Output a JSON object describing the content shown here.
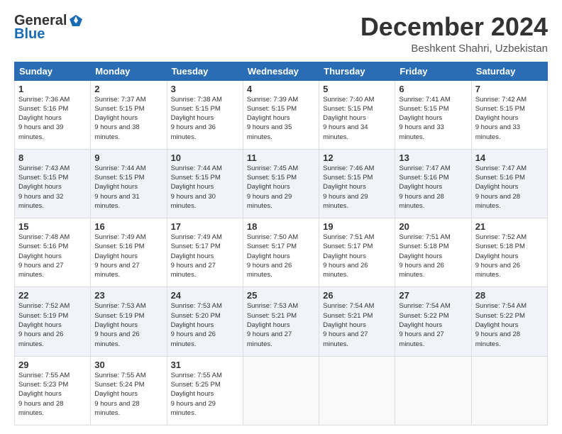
{
  "header": {
    "logo_general": "General",
    "logo_blue": "Blue",
    "month_title": "December 2024",
    "location": "Beshkent Shahri, Uzbekistan"
  },
  "days_of_week": [
    "Sunday",
    "Monday",
    "Tuesday",
    "Wednesday",
    "Thursday",
    "Friday",
    "Saturday"
  ],
  "weeks": [
    [
      {
        "day": "1",
        "sunrise": "7:36 AM",
        "sunset": "5:16 PM",
        "daylight": "9 hours and 39 minutes."
      },
      {
        "day": "2",
        "sunrise": "7:37 AM",
        "sunset": "5:15 PM",
        "daylight": "9 hours and 38 minutes."
      },
      {
        "day": "3",
        "sunrise": "7:38 AM",
        "sunset": "5:15 PM",
        "daylight": "9 hours and 36 minutes."
      },
      {
        "day": "4",
        "sunrise": "7:39 AM",
        "sunset": "5:15 PM",
        "daylight": "9 hours and 35 minutes."
      },
      {
        "day": "5",
        "sunrise": "7:40 AM",
        "sunset": "5:15 PM",
        "daylight": "9 hours and 34 minutes."
      },
      {
        "day": "6",
        "sunrise": "7:41 AM",
        "sunset": "5:15 PM",
        "daylight": "9 hours and 33 minutes."
      },
      {
        "day": "7",
        "sunrise": "7:42 AM",
        "sunset": "5:15 PM",
        "daylight": "9 hours and 33 minutes."
      }
    ],
    [
      {
        "day": "8",
        "sunrise": "7:43 AM",
        "sunset": "5:15 PM",
        "daylight": "9 hours and 32 minutes."
      },
      {
        "day": "9",
        "sunrise": "7:44 AM",
        "sunset": "5:15 PM",
        "daylight": "9 hours and 31 minutes."
      },
      {
        "day": "10",
        "sunrise": "7:44 AM",
        "sunset": "5:15 PM",
        "daylight": "9 hours and 30 minutes."
      },
      {
        "day": "11",
        "sunrise": "7:45 AM",
        "sunset": "5:15 PM",
        "daylight": "9 hours and 29 minutes."
      },
      {
        "day": "12",
        "sunrise": "7:46 AM",
        "sunset": "5:15 PM",
        "daylight": "9 hours and 29 minutes."
      },
      {
        "day": "13",
        "sunrise": "7:47 AM",
        "sunset": "5:16 PM",
        "daylight": "9 hours and 28 minutes."
      },
      {
        "day": "14",
        "sunrise": "7:47 AM",
        "sunset": "5:16 PM",
        "daylight": "9 hours and 28 minutes."
      }
    ],
    [
      {
        "day": "15",
        "sunrise": "7:48 AM",
        "sunset": "5:16 PM",
        "daylight": "9 hours and 27 minutes."
      },
      {
        "day": "16",
        "sunrise": "7:49 AM",
        "sunset": "5:16 PM",
        "daylight": "9 hours and 27 minutes."
      },
      {
        "day": "17",
        "sunrise": "7:49 AM",
        "sunset": "5:17 PM",
        "daylight": "9 hours and 27 minutes."
      },
      {
        "day": "18",
        "sunrise": "7:50 AM",
        "sunset": "5:17 PM",
        "daylight": "9 hours and 26 minutes."
      },
      {
        "day": "19",
        "sunrise": "7:51 AM",
        "sunset": "5:17 PM",
        "daylight": "9 hours and 26 minutes."
      },
      {
        "day": "20",
        "sunrise": "7:51 AM",
        "sunset": "5:18 PM",
        "daylight": "9 hours and 26 minutes."
      },
      {
        "day": "21",
        "sunrise": "7:52 AM",
        "sunset": "5:18 PM",
        "daylight": "9 hours and 26 minutes."
      }
    ],
    [
      {
        "day": "22",
        "sunrise": "7:52 AM",
        "sunset": "5:19 PM",
        "daylight": "9 hours and 26 minutes."
      },
      {
        "day": "23",
        "sunrise": "7:53 AM",
        "sunset": "5:19 PM",
        "daylight": "9 hours and 26 minutes."
      },
      {
        "day": "24",
        "sunrise": "7:53 AM",
        "sunset": "5:20 PM",
        "daylight": "9 hours and 26 minutes."
      },
      {
        "day": "25",
        "sunrise": "7:53 AM",
        "sunset": "5:21 PM",
        "daylight": "9 hours and 27 minutes."
      },
      {
        "day": "26",
        "sunrise": "7:54 AM",
        "sunset": "5:21 PM",
        "daylight": "9 hours and 27 minutes."
      },
      {
        "day": "27",
        "sunrise": "7:54 AM",
        "sunset": "5:22 PM",
        "daylight": "9 hours and 27 minutes."
      },
      {
        "day": "28",
        "sunrise": "7:54 AM",
        "sunset": "5:22 PM",
        "daylight": "9 hours and 28 minutes."
      }
    ],
    [
      {
        "day": "29",
        "sunrise": "7:55 AM",
        "sunset": "5:23 PM",
        "daylight": "9 hours and 28 minutes."
      },
      {
        "day": "30",
        "sunrise": "7:55 AM",
        "sunset": "5:24 PM",
        "daylight": "9 hours and 28 minutes."
      },
      {
        "day": "31",
        "sunrise": "7:55 AM",
        "sunset": "5:25 PM",
        "daylight": "9 hours and 29 minutes."
      },
      null,
      null,
      null,
      null
    ]
  ]
}
